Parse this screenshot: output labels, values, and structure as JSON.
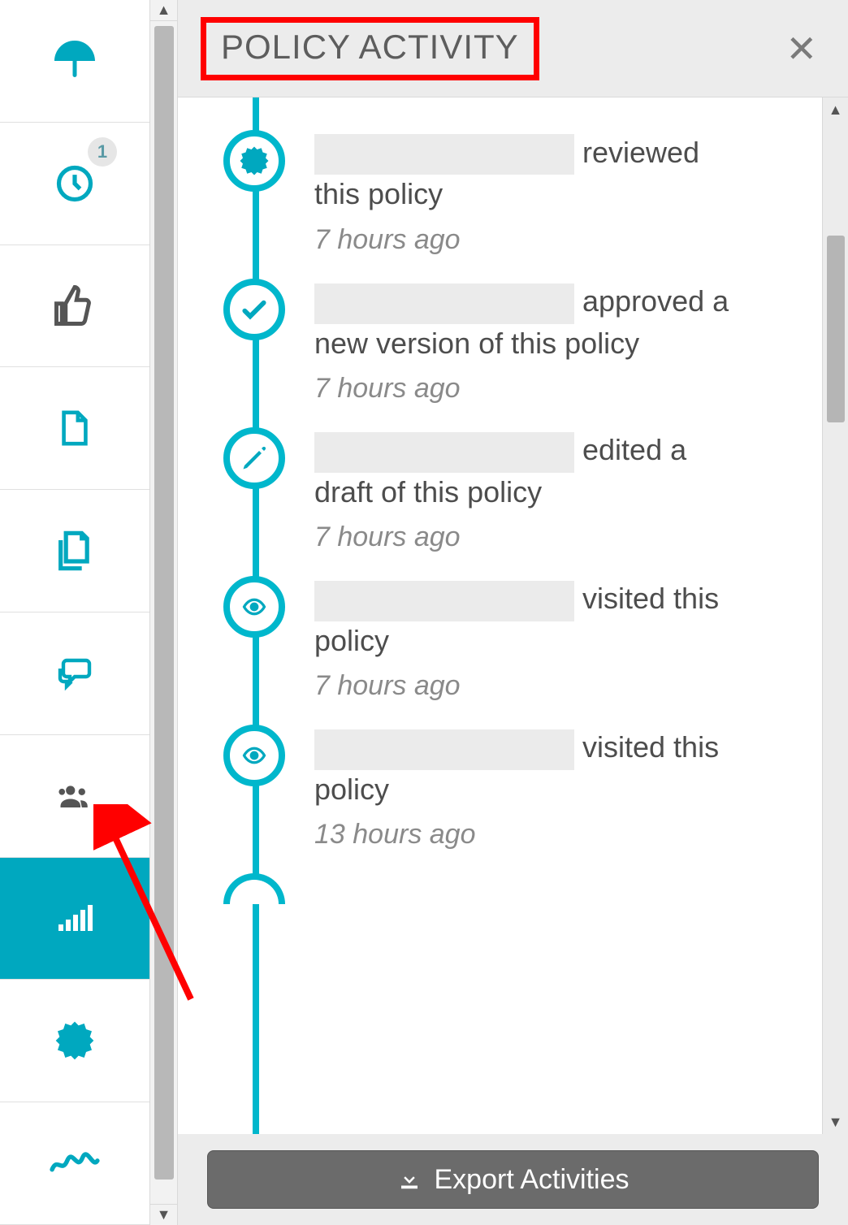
{
  "sidebar": {
    "items": [
      {
        "name": "umbrella",
        "badge": null
      },
      {
        "name": "clock",
        "badge": "1"
      },
      {
        "name": "thumbs-up",
        "badge": null
      },
      {
        "name": "file",
        "badge": null
      },
      {
        "name": "files",
        "badge": null
      },
      {
        "name": "comments",
        "badge": null
      },
      {
        "name": "users",
        "badge": null
      },
      {
        "name": "signal",
        "badge": null,
        "active": true
      },
      {
        "name": "certificate",
        "badge": null
      },
      {
        "name": "signature",
        "badge": null
      }
    ]
  },
  "panel": {
    "title": "POLICY ACTIVITY"
  },
  "activities": [
    {
      "icon": "certificate",
      "action": "reviewed this policy",
      "time": "7 hours ago"
    },
    {
      "icon": "check",
      "action": "approved a new version of this policy",
      "time": "7 hours ago"
    },
    {
      "icon": "pencil",
      "action": "edited a draft of this policy",
      "time": "7 hours ago"
    },
    {
      "icon": "eye",
      "action": "visited this policy",
      "time": "7 hours ago"
    },
    {
      "icon": "eye",
      "action": "visited this policy",
      "time": "13 hours ago"
    }
  ],
  "footer": {
    "export_label": "Export Activities"
  }
}
